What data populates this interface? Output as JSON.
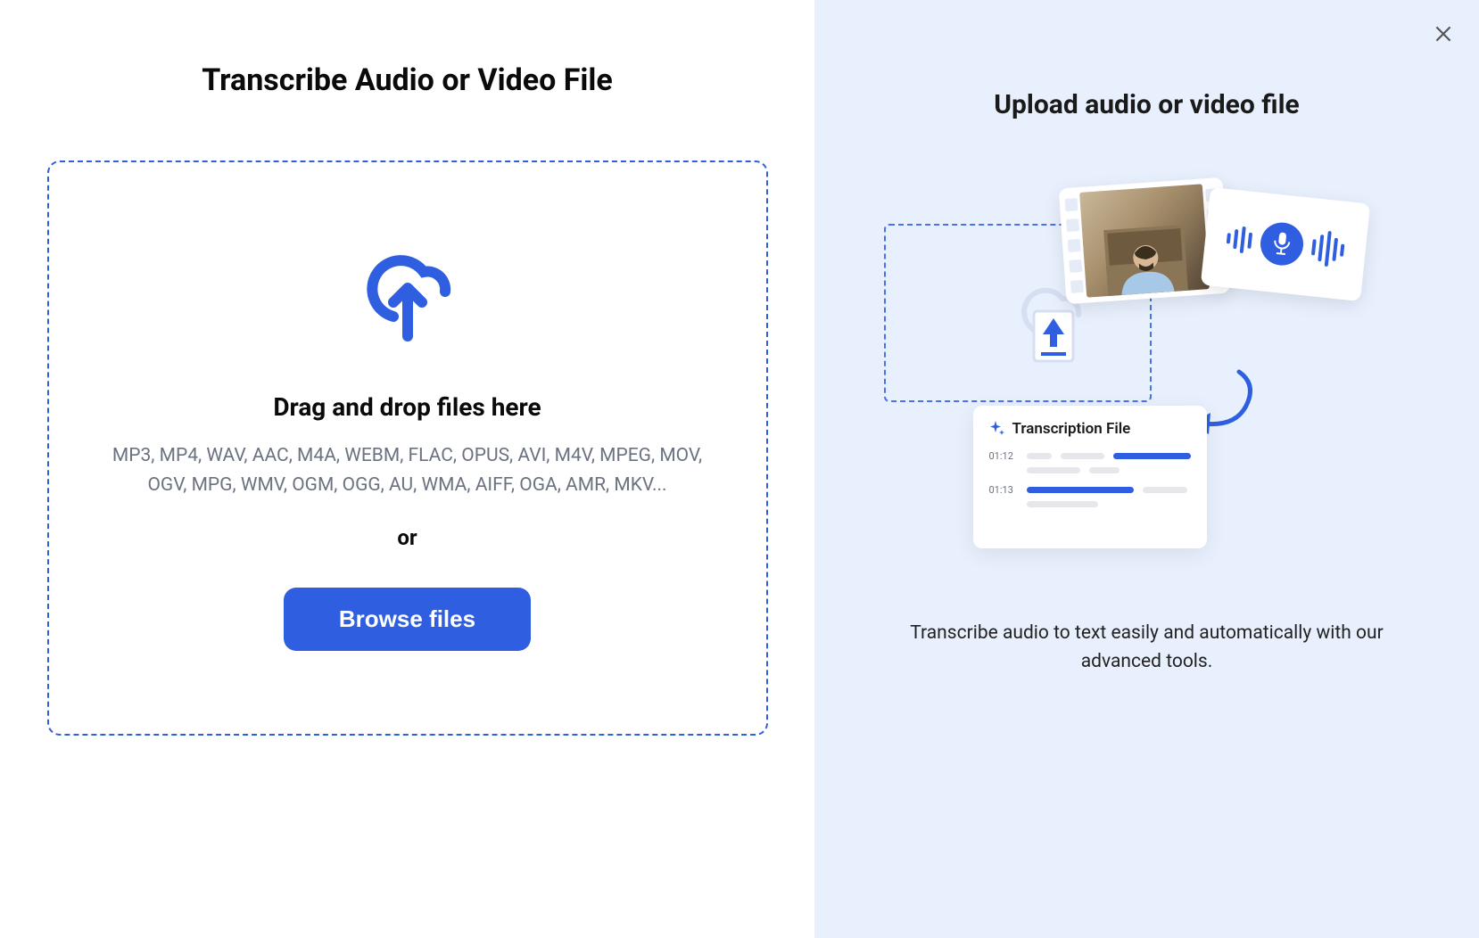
{
  "left": {
    "title": "Transcribe Audio or Video File",
    "dropzone": {
      "icon": "cloud-upload-icon",
      "headline": "Drag and drop files here",
      "formats": "MP3, MP4, WAV, AAC, M4A, WEBM, FLAC, OPUS, AVI, M4V, MPEG, MOV, OGV, MPG, WMV, OGM, OGG, AU, WMA, AIFF, OGA, AMR, MKV...",
      "or": "or",
      "button": "Browse files"
    }
  },
  "right": {
    "title": "Upload audio or video file",
    "illustration": {
      "transcript_title": "Transcription File",
      "time1": "01:12",
      "time2": "01:13"
    },
    "description": "Transcribe audio to text easily and automatically with our advanced tools."
  },
  "colors": {
    "accent": "#2f5fe0",
    "panel_bg": "#e8f0fe",
    "muted": "#6b7280"
  }
}
